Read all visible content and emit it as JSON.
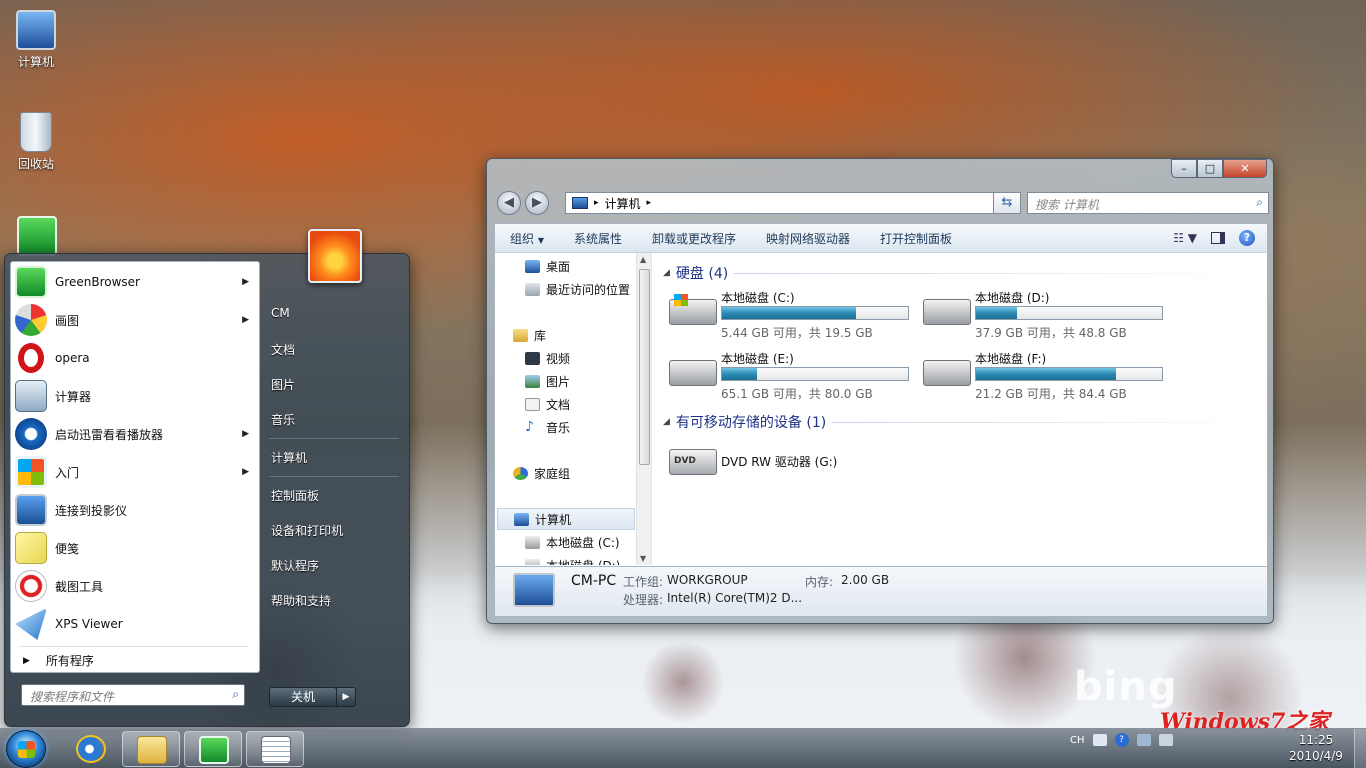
{
  "desktop": {
    "icons": [
      {
        "label": "计算机",
        "icon": "computer-icon"
      },
      {
        "label": "回收站",
        "icon": "recycle-bin-icon"
      }
    ],
    "bing_logo": "bing",
    "watermark": "Windows7之家"
  },
  "explorer": {
    "caption_buttons": {
      "minimize": "–",
      "maximize": "□",
      "close": "✕"
    },
    "back": "◀",
    "forward": "▶",
    "address": [
      "计算机"
    ],
    "search_placeholder": "搜索 计算机",
    "toolbar": [
      "组织",
      "系统属性",
      "卸载或更改程序",
      "映射网络驱动器",
      "打开控制面板"
    ],
    "nav": {
      "favorites": [
        "桌面",
        "最近访问的位置"
      ],
      "library_title": "库",
      "library": [
        "视频",
        "图片",
        "文档",
        "音乐"
      ],
      "homegroup": "家庭组",
      "computer": "计算机",
      "drives": [
        "本地磁盘 (C:)",
        "本地磁盘 (D:)"
      ]
    },
    "groups": {
      "hard_disks": "硬盘 (4)",
      "removable": "有可移动存储的设备 (1)"
    },
    "drives": [
      {
        "name": "本地磁盘 (C:)",
        "info": "5.44 GB 可用，共 19.5 GB",
        "used_fraction": 0.72,
        "system": true
      },
      {
        "name": "本地磁盘 (D:)",
        "info": "37.9 GB 可用，共 48.8 GB",
        "used_fraction": 0.22,
        "system": false
      },
      {
        "name": "本地磁盘 (E:)",
        "info": "65.1 GB 可用，共 80.0 GB",
        "used_fraction": 0.19,
        "system": false
      },
      {
        "name": "本地磁盘 (F:)",
        "info": "21.2 GB 可用，共 84.4 GB",
        "used_fraction": 0.75,
        "system": false
      }
    ],
    "dvd": {
      "name": "DVD RW 驱动器 (G:)",
      "badge": "DVD"
    },
    "details": {
      "pc_name": "CM-PC",
      "workgroup_label": "工作组:",
      "workgroup": "WORKGROUP",
      "memory_label": "内存:",
      "memory": "2.00 GB",
      "cpu_label": "处理器:",
      "cpu": "Intel(R) Core(TM)2 D..."
    }
  },
  "start_menu": {
    "programs": [
      {
        "label": "GreenBrowser",
        "submenu": true
      },
      {
        "label": "画图",
        "submenu": true
      },
      {
        "label": "opera",
        "submenu": false
      },
      {
        "label": "计算器",
        "submenu": false
      },
      {
        "label": "启动迅雷看看播放器",
        "submenu": true
      },
      {
        "label": "入门",
        "submenu": true
      },
      {
        "label": "连接到投影仪",
        "submenu": false
      },
      {
        "label": "便笺",
        "submenu": false
      },
      {
        "label": "截图工具",
        "submenu": false
      },
      {
        "label": "XPS Viewer",
        "submenu": false
      }
    ],
    "all_programs": "所有程序",
    "search_placeholder": "搜索程序和文件",
    "right": [
      "CM",
      "文档",
      "图片",
      "音乐",
      "计算机",
      "控制面板",
      "设备和打印机",
      "默认程序",
      "帮助和支持"
    ],
    "shutdown": "关机"
  },
  "taskbar": {
    "lang": "CH",
    "time": "11:25",
    "date": "2010/4/9"
  }
}
